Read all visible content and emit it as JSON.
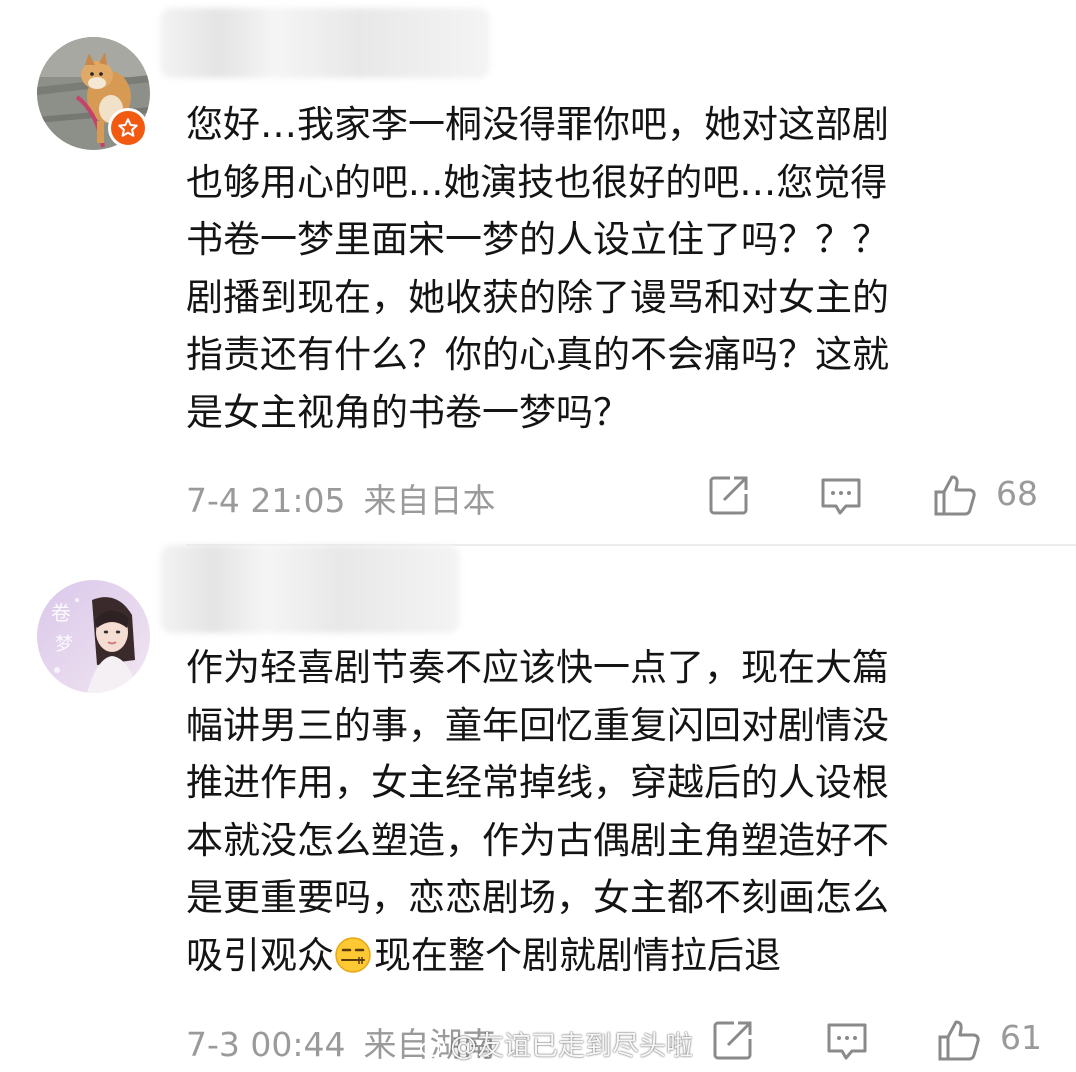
{
  "comments": [
    {
      "lines": [
        "您好…我家李一桐没得罪你吧，她对这部剧",
        "也够用心的吧...她演技也很好的吧…您觉得",
        "书卷一梦里面宋一梦的人设立住了吗？？？",
        "剧播到现在，她收获的除了谩骂和对女主的",
        "指责还有什么？你的心真的不会痛吗？这就",
        "是女主视角的书卷一梦吗？"
      ],
      "time": "7-4 21:05",
      "source": "来自日本",
      "likes": "68",
      "avatar_icon": "shiba-dog-avatar",
      "badge_icon": "verified-star-icon"
    },
    {
      "lines_before_emoji": [
        "作为轻喜剧节奏不应该快一点了，现在大篇",
        "幅讲男三的事，童年回忆重复闪回对剧情没",
        "推进作用，女主经常掉线，穿越后的人设根",
        "本就没怎么塑造，作为古偶剧主角塑造好不",
        "是更重要吗，恋恋剧场，女主都不刻画怎么"
      ],
      "last_line_start": "吸引观众",
      "last_line_end": "现在整个剧就剧情拉后退",
      "emoji_icon": "speechless-face-emoji",
      "time": "7-3 00:44",
      "source": "来自湖南",
      "likes": "61",
      "avatar_icon": "drama-poster-avatar"
    }
  ],
  "watermark": "@友谊已走到尽头啦",
  "colors": {
    "text": "#141414",
    "meta": "#9a9a9a",
    "badge": "#f25a12"
  }
}
